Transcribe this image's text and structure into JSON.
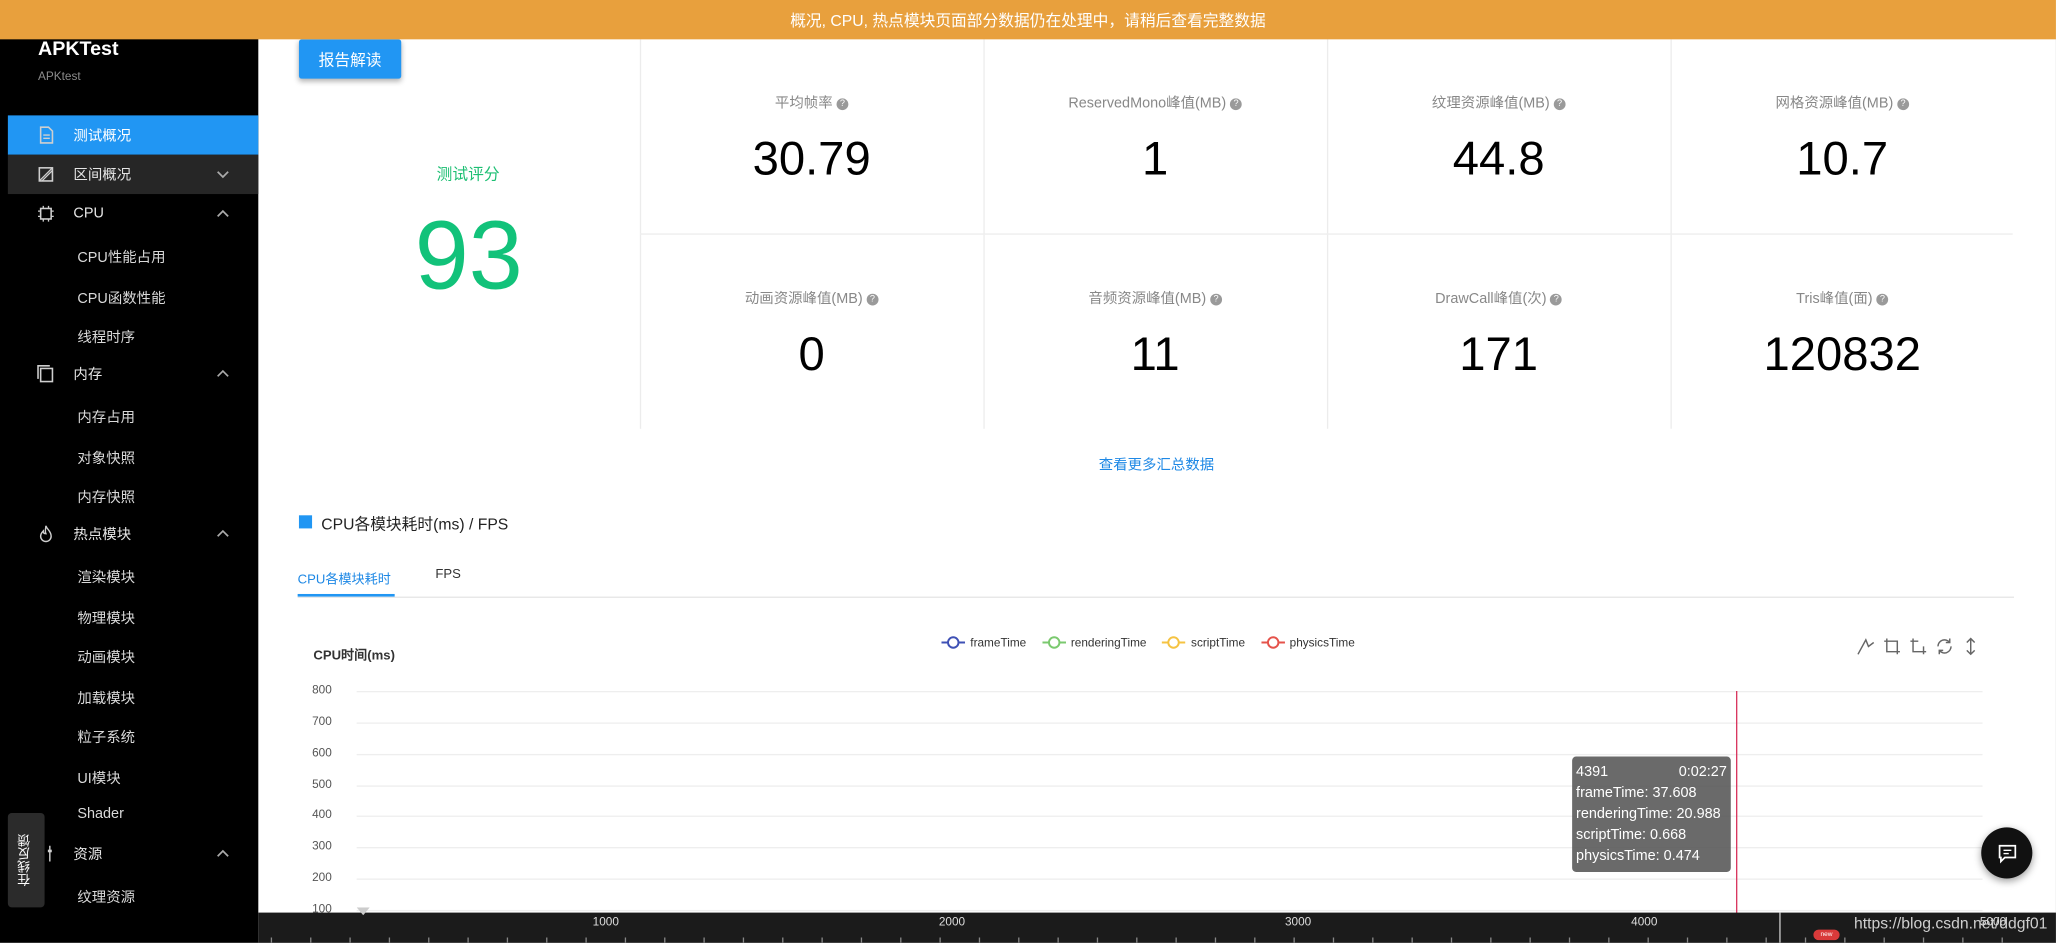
{
  "banner": {
    "text": "概况, CPU, 热点模块页面部分数据仍在处理中，请稍后查看完整数据"
  },
  "sidebar": {
    "app_title": "APKTest",
    "app_subtitle": "APKtest",
    "items": [
      {
        "label": "测试概况",
        "icon": "document-icon",
        "active": true
      },
      {
        "label": "区间概况",
        "icon": "range-icon",
        "expanded": false
      },
      {
        "label": "CPU",
        "icon": "cpu-icon",
        "expanded": true,
        "children": [
          "CPU性能占用",
          "CPU函数性能",
          "线程时序"
        ]
      },
      {
        "label": "内存",
        "icon": "memory-icon",
        "expanded": true,
        "children": [
          "内存占用",
          "对象快照",
          "内存快照"
        ]
      },
      {
        "label": "热点模块",
        "icon": "flame-icon",
        "expanded": true,
        "children": [
          "渲染模块",
          "物理模块",
          "动画模块",
          "加载模块",
          "粒子系统",
          "UI模块",
          "Shader"
        ]
      },
      {
        "label": "资源",
        "icon": "sliders-icon",
        "expanded": true,
        "children": [
          "纹理资源"
        ]
      }
    ],
    "feedback_label": "在线反馈"
  },
  "report_button": "报告解读",
  "score": {
    "label": "测试评分",
    "value": "93"
  },
  "metrics": [
    {
      "label": "平均帧率",
      "value": "30.79"
    },
    {
      "label": "ReservedMono峰值(MB)",
      "value": "1"
    },
    {
      "label": "纹理资源峰值(MB)",
      "value": "44.8"
    },
    {
      "label": "网格资源峰值(MB)",
      "value": "10.7"
    },
    {
      "label": "动画资源峰值(MB)",
      "value": "0"
    },
    {
      "label": "音频资源峰值(MB)",
      "value": "11"
    },
    {
      "label": "DrawCall峰值(次)",
      "value": "171"
    },
    {
      "label": "Tris峰值(面)",
      "value": "120832"
    }
  ],
  "more_link": "查看更多汇总数据",
  "section": {
    "title": "CPU各模块耗时(ms) / FPS",
    "tabs": [
      {
        "label": "CPU各模块耗时",
        "active": true
      },
      {
        "label": "FPS",
        "active": false
      }
    ]
  },
  "chart": {
    "ylabel": "CPU时间(ms)",
    "legend": [
      {
        "name": "frameTime",
        "color": "#3F51B5"
      },
      {
        "name": "renderingTime",
        "color": "#7BC96F"
      },
      {
        "name": "scriptTime",
        "color": "#F5C342"
      },
      {
        "name": "physicsTime",
        "color": "#E5534B"
      }
    ],
    "toolbox": [
      "zoom-icon",
      "zoom-area-icon",
      "zoom-reset-icon",
      "restore-icon",
      "vertical-resize-icon"
    ],
    "tooltip": {
      "frame": "4391",
      "time": "0:02:27",
      "lines": [
        "frameTime: 37.608",
        "renderingTime: 20.988",
        "scriptTime: 0.668",
        "physicsTime: 0.474"
      ]
    },
    "slider_labels": [
      "1000",
      "2000",
      "3000",
      "4000",
      "5000"
    ],
    "new_badge": "new"
  },
  "chart_data": {
    "type": "line",
    "series": [
      {
        "name": "frameTime",
        "values": [
          37.608
        ]
      },
      {
        "name": "renderingTime",
        "values": [
          20.988
        ]
      },
      {
        "name": "scriptTime",
        "values": [
          0.668
        ]
      },
      {
        "name": "physicsTime",
        "values": [
          0.474
        ]
      }
    ],
    "x": [
      4391
    ],
    "ylabel": "CPU时间(ms)",
    "yticks": [
      "800",
      "700",
      "600",
      "500",
      "400",
      "300",
      "200",
      "100"
    ],
    "ylim": [
      100,
      800
    ],
    "grid": true,
    "legend": "top-center"
  },
  "watermark": "https://blog.csdn.net/ddgf01"
}
